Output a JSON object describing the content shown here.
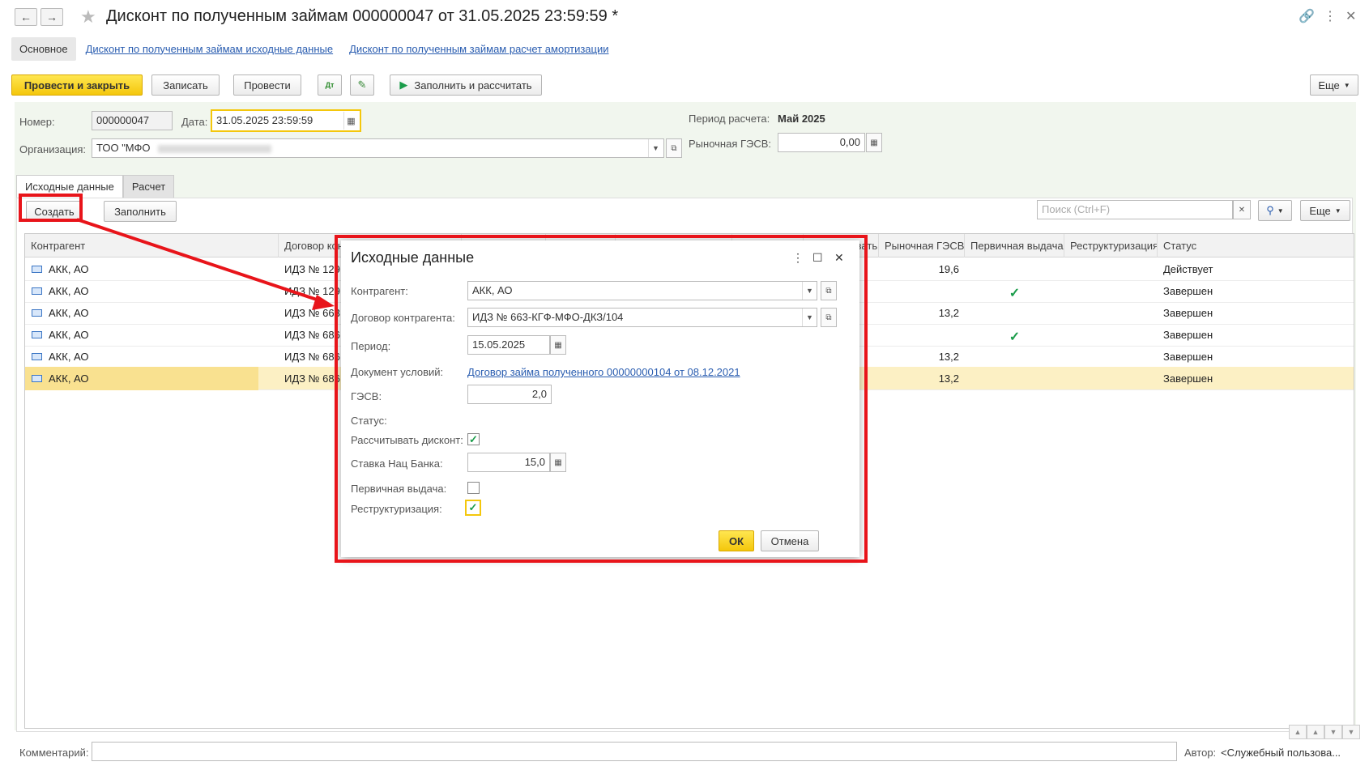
{
  "window": {
    "title": "Дисконт по полученным займам 000000047 от 31.05.2025 23:59:59 *"
  },
  "form_tabs": {
    "main": "Основное",
    "link1": "Дисконт по полученным займам исходные данные",
    "link2": "Дисконт по полученным займам расчет амортизации"
  },
  "toolbar": {
    "post_close": "Провести и закрыть",
    "save": "Записать",
    "post": "Провести",
    "fill_calc": "Заполнить и рассчитать",
    "more": "Еще"
  },
  "header": {
    "number_label": "Номер:",
    "number": "000000047",
    "date_label": "Дата:",
    "date": "31.05.2025 23:59:59",
    "org_label": "Организация:",
    "org": "ТОО \"МФО",
    "period_label": "Период расчета:",
    "period": "Май 2025",
    "market_label": "Рыночная ГЭСВ:",
    "market": "0,00"
  },
  "tabs": {
    "source": "Исходные данные",
    "calc": "Расчет"
  },
  "table_bar": {
    "create": "Создать",
    "fill": "Заполнить",
    "search_placeholder": "Поиск (Ctrl+F)",
    "more": "Еще"
  },
  "table": {
    "columns": [
      "Контрагент",
      "Договор контрагента",
      "",
      "",
      "",
      "",
      "Рассчитывать",
      "Рыночная ГЭСВ",
      "Первичная выдача",
      "Реструктуризация",
      "Статус"
    ],
    "rows": [
      {
        "contractor": "АКК, АО",
        "contract": "ИДЗ № 129",
        "market": "19,6",
        "primary": "",
        "status": "Действует"
      },
      {
        "contractor": "АКК, АО",
        "contract": "ИДЗ № 129",
        "market": "",
        "primary": "✓",
        "status": "Завершен"
      },
      {
        "contractor": "АКК, АО",
        "contract": "ИДЗ № 663",
        "market": "13,2",
        "primary": "",
        "status": "Завершен"
      },
      {
        "contractor": "АКК, АО",
        "contract": "ИДЗ № 686",
        "market": "",
        "primary": "✓",
        "status": "Завершен"
      },
      {
        "contractor": "АКК, АО",
        "contract": "ИДЗ № 686",
        "market": "13,2",
        "primary": "",
        "status": "Завершен"
      },
      {
        "contractor": "АКК, АО",
        "contract": "ИДЗ № 686",
        "market": "13,2",
        "primary": "",
        "status": "Завершен"
      }
    ]
  },
  "dialog": {
    "title": "Исходные данные",
    "contractor_label": "Контрагент:",
    "contractor": "АКК, АО",
    "contract_label": "Договор контрагента:",
    "contract": "ИДЗ № 663-КГФ-МФО-ДКЗ/104",
    "period_label": "Период:",
    "period": "15.05.2025",
    "doc_label": "Документ условий:",
    "doc": "Договор займа полученного 00000000104 от 08.12.2021",
    "gesv_label": "ГЭСВ:",
    "gesv": "2,0",
    "status_label": "Статус:",
    "calc_discount_label": "Рассчитывать дисконт:",
    "nb_rate_label": "Ставка Нац Банка:",
    "nb_rate": "15,0",
    "primary_label": "Первичная выдача:",
    "restruct_label": "Реструктуризация:",
    "ok": "ОК",
    "cancel": "Отмена"
  },
  "footer": {
    "comment_label": "Комментарий:",
    "author_label": "Автор:",
    "author": "<Служебный пользова..."
  },
  "colors": {
    "accent_yellow": "#f4c70c",
    "annotation_red": "#e8141a",
    "link_blue": "#2a5db0",
    "check_green": "#1a9c4a"
  }
}
